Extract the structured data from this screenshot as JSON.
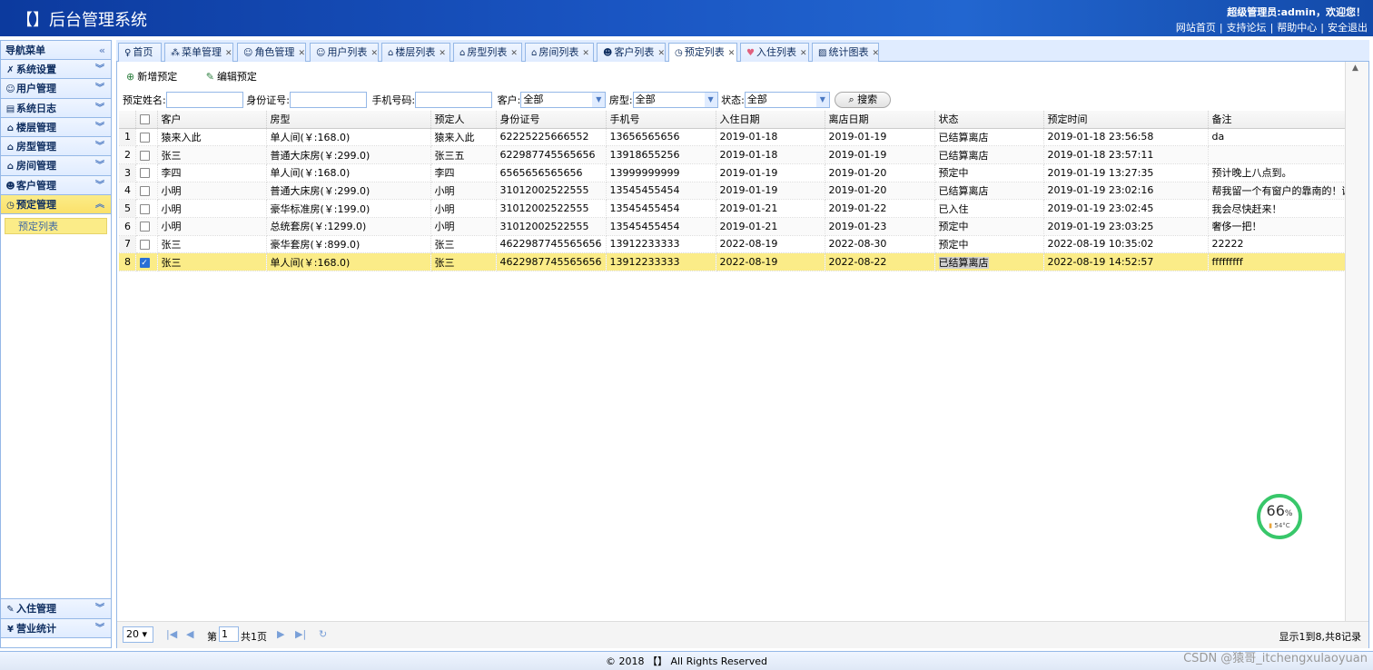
{
  "header": {
    "title": "【】后台管理系统",
    "user_text": "超级管理员:admin，欢迎您！",
    "links": [
      "网站首页",
      "支持论坛",
      "帮助中心",
      "安全退出"
    ]
  },
  "sidebar": {
    "title": "导航菜单",
    "items": [
      {
        "label": "系统设置",
        "icon": "wrench-icon"
      },
      {
        "label": "用户管理",
        "icon": "user-icon"
      },
      {
        "label": "系统日志",
        "icon": "log-icon"
      },
      {
        "label": "楼层管理",
        "icon": "building-icon"
      },
      {
        "label": "房型管理",
        "icon": "house-icon"
      },
      {
        "label": "房间管理",
        "icon": "room-icon"
      },
      {
        "label": "客户管理",
        "icon": "customer-icon"
      },
      {
        "label": "预定管理",
        "icon": "clock-icon"
      }
    ],
    "sub_item": "预定列表",
    "bottom_items": [
      {
        "label": "入住管理",
        "icon": "checkin-icon"
      },
      {
        "label": "营业统计",
        "icon": "yen-icon"
      }
    ]
  },
  "tabs": [
    "首页",
    "菜单管理",
    "角色管理",
    "用户列表",
    "楼层列表",
    "房型列表",
    "房间列表",
    "客户列表",
    "预定列表",
    "入住列表",
    "统计图表"
  ],
  "toolbar": {
    "add_label": "新增预定",
    "edit_label": "编辑预定"
  },
  "filters": {
    "name_label": "预定姓名:",
    "id_label": "身份证号:",
    "phone_label": "手机号码:",
    "customer_label": "客户:",
    "customer_value": "全部",
    "roomtype_label": "房型:",
    "roomtype_value": "全部",
    "status_label": "状态:",
    "status_value": "全部",
    "search_label": "搜索"
  },
  "grid": {
    "columns": [
      "客户",
      "房型",
      "预定人",
      "身份证号",
      "手机号",
      "入住日期",
      "离店日期",
      "状态",
      "预定时间",
      "备注"
    ],
    "rows": [
      {
        "n": "1",
        "c": [
          "猿来入此",
          "单人间(￥:168.0)",
          "猿来入此",
          "62225225666552",
          "13656565656",
          "2019-01-18",
          "2019-01-19",
          "已结算离店",
          "2019-01-18 23:56:58",
          "da"
        ]
      },
      {
        "n": "2",
        "c": [
          "张三",
          "普通大床房(￥:299.0)",
          "张三五",
          "622987745565656",
          "13918655256",
          "2019-01-18",
          "2019-01-19",
          "已结算离店",
          "2019-01-18 23:57:11",
          ""
        ]
      },
      {
        "n": "3",
        "c": [
          "李四",
          "单人间(￥:168.0)",
          "李四",
          "6565656565656",
          "13999999999",
          "2019-01-19",
          "2019-01-20",
          "预定中",
          "2019-01-19 13:27:35",
          "预计晚上八点到。"
        ]
      },
      {
        "n": "4",
        "c": [
          "小明",
          "普通大床房(￥:299.0)",
          "小明",
          "31012002522555",
          "13545455454",
          "2019-01-19",
          "2019-01-20",
          "已结算离店",
          "2019-01-19 23:02:16",
          "帮我留一个有窗户的靠南的！谢谢！"
        ]
      },
      {
        "n": "5",
        "c": [
          "小明",
          "豪华标准房(￥:199.0)",
          "小明",
          "31012002522555",
          "13545455454",
          "2019-01-21",
          "2019-01-22",
          "已入住",
          "2019-01-19 23:02:45",
          "我会尽快赶来！"
        ]
      },
      {
        "n": "6",
        "c": [
          "小明",
          "总统套房(￥:1299.0)",
          "小明",
          "31012002522555",
          "13545455454",
          "2019-01-21",
          "2019-01-23",
          "预定中",
          "2019-01-19 23:03:25",
          "奢侈一把！"
        ]
      },
      {
        "n": "7",
        "c": [
          "张三",
          "豪华套房(￥:899.0)",
          "张三",
          "4622987745565656",
          "13912233333",
          "2022-08-19",
          "2022-08-30",
          "预定中",
          "2022-08-19 10:35:02",
          "22222"
        ]
      },
      {
        "n": "8",
        "c": [
          "张三",
          "单人间(￥:168.0)",
          "张三",
          "4622987745565656",
          "13912233333",
          "2022-08-19",
          "2022-08-22",
          "已结算离店",
          "2022-08-19 14:52:57",
          "fffffffff"
        ]
      }
    ]
  },
  "pager": {
    "page_size": "20",
    "page_prefix": "第",
    "page_value": "1",
    "page_total": "共1页",
    "info": "显示1到8,共8记录"
  },
  "footer": {
    "text": "© 2018 【】 All Rights Reserved",
    "watermark": "CSDN @猿哥_itchengxulaoyuan"
  },
  "gauge": {
    "percent": "66",
    "unit": "%",
    "temp": "54°C"
  }
}
